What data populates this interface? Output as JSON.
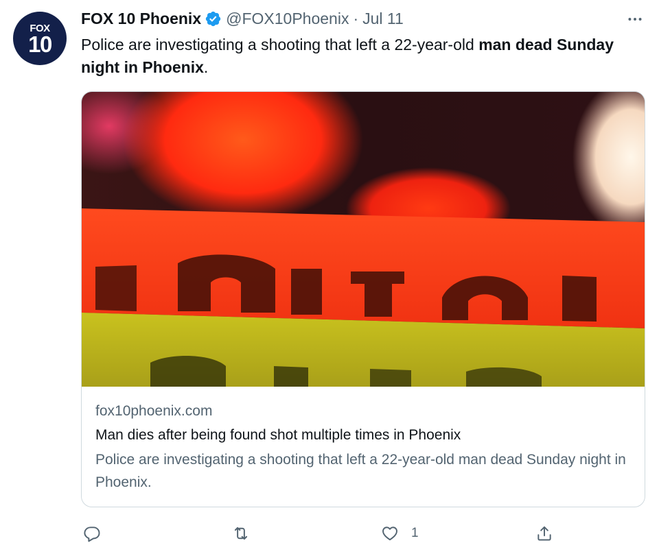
{
  "author": {
    "avatar_top": "FOX",
    "avatar_bottom": "10",
    "name": "FOX 10 Phoenix",
    "handle": "@FOX10Phoenix",
    "separator": "·",
    "date": "Jul 11"
  },
  "tweet": {
    "text_plain": "Police are investigating a shooting that left a 22-year-old ",
    "text_bold": "man dead Sunday night in Phoenix",
    "text_end": "."
  },
  "card": {
    "domain": "fox10phoenix.com",
    "title": "Man dies after being found shot multiple times in Phoenix",
    "description": "Police are investigating a shooting that left a 22-year-old man dead Sunday night in Phoenix."
  },
  "actions": {
    "reply_count": "",
    "retweet_count": "",
    "like_count": "1"
  },
  "colors": {
    "verified": "#1d9bf0",
    "secondary_text": "#536471",
    "border": "#cfd9de",
    "avatar_bg": "#13204a"
  },
  "icons": [
    "verified-badge-icon",
    "more-icon",
    "reply-icon",
    "retweet-icon",
    "like-icon",
    "share-icon"
  ]
}
